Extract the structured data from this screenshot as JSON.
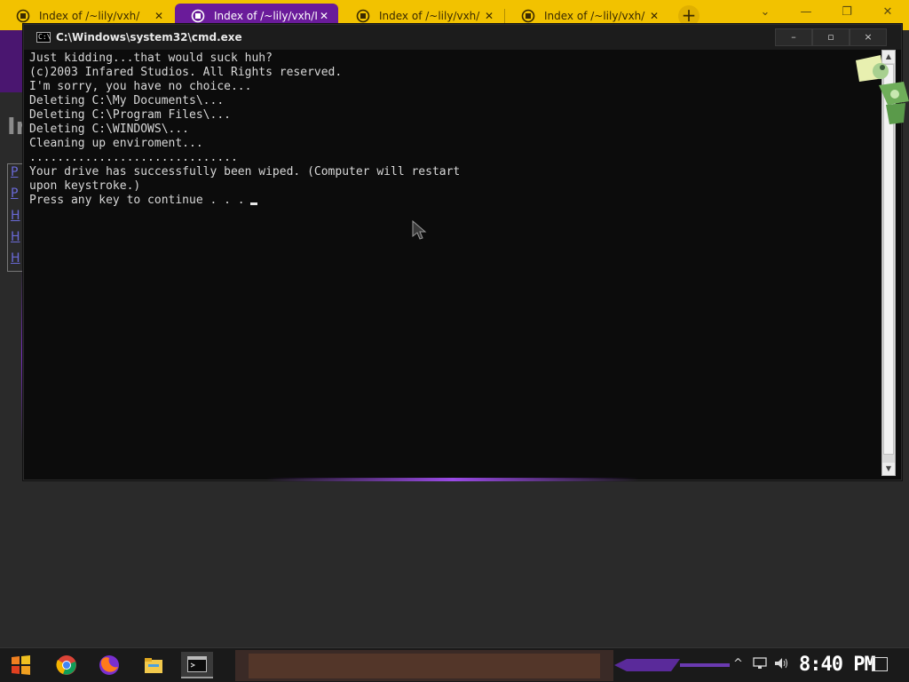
{
  "browser": {
    "tabs": [
      {
        "label": "Index of /~lily/vxh/",
        "close": "✕",
        "active": false
      },
      {
        "label": "Index of /~lily/vxh/I",
        "close": "✕",
        "active": true
      },
      {
        "label": "Index of /~lily/vxh/",
        "close": "✕",
        "active": false
      },
      {
        "label": "Index of /~lily/vxh/",
        "close": "✕",
        "active": false
      }
    ],
    "new_tab": "+",
    "controls": {
      "dropdown": "⌄",
      "minimize": "—",
      "restore": "❐",
      "close": "✕"
    },
    "background_page": {
      "heading": "Ir",
      "links": [
        "P",
        "P",
        "H",
        "H",
        "H"
      ]
    }
  },
  "cmd": {
    "title": "C:\\Windows\\system32\\cmd.exe",
    "icon_text": "C:\\",
    "buttons": {
      "minimize": "–",
      "maximize": "▫",
      "close": "×"
    },
    "lines": [
      "Just kidding...that would suck huh?",
      "(c)2003 Infared Studios. All Rights reserved.",
      "I'm sorry, you have no choice...",
      "Deleting C:\\My Documents\\...",
      "Deleting C:\\Program Files\\...",
      "Deleting C:\\WINDOWS\\...",
      "Cleaning up enviroment...",
      "..............................",
      "Your drive has successfully been wiped. (Computer will restart",
      "upon keystroke.)",
      "Press any key to continue . . ."
    ],
    "scroll_up": "▲",
    "scroll_down": "▼"
  },
  "taskbar": {
    "clock": "8:40 PM",
    "tray_chevron": "^",
    "apps": [
      "start-icon",
      "chrome-icon",
      "firefox-icon",
      "file-explorer-icon",
      "cmd-icon"
    ]
  },
  "colors": {
    "tab_bar": "#f2c200",
    "active_tab": "#6a1b9a",
    "console_bg": "#0c0c0c",
    "console_fg": "#d8d8d8",
    "accent_glow": "#9a4ae6"
  }
}
